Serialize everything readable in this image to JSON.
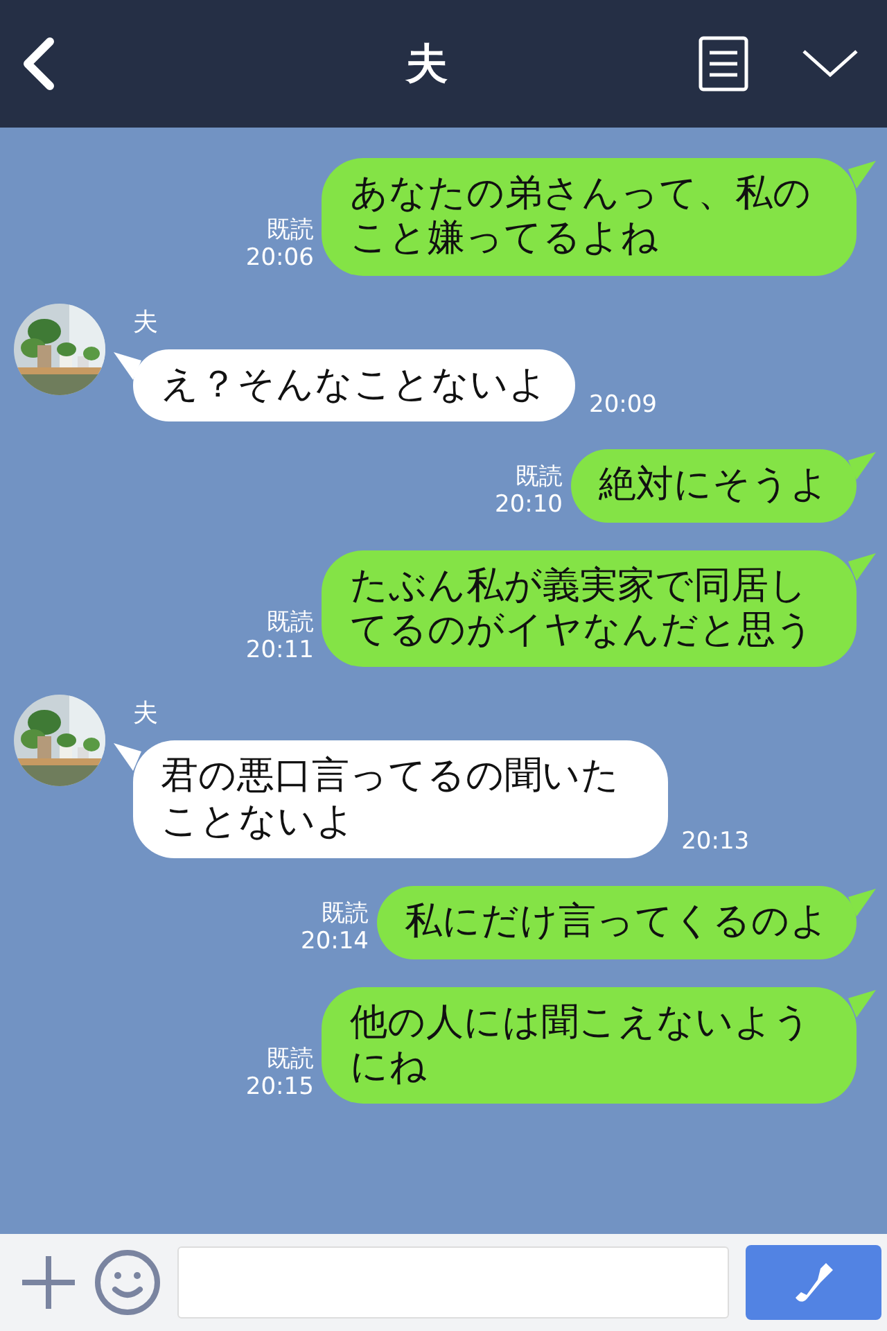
{
  "header": {
    "title": "夫"
  },
  "messages": [
    {
      "kind": "sent",
      "text": "あなたの弟さんって、私のこと嫌ってるよね",
      "read": "既読",
      "time": "20:06"
    },
    {
      "kind": "received",
      "sender": "夫",
      "text": "え？そんなことないよ",
      "time": "20:09"
    },
    {
      "kind": "sent",
      "text": "絶対にそうよ",
      "read": "既読",
      "time": "20:10"
    },
    {
      "kind": "sent",
      "text": "たぶん私が義実家で同居してるのがイヤなんだと思う",
      "read": "既読",
      "time": "20:11"
    },
    {
      "kind": "received",
      "sender": "夫",
      "text": "君の悪口言ってるの聞いたことないよ",
      "time": "20:13"
    },
    {
      "kind": "sent",
      "text": "私にだけ言ってくるのよ",
      "read": "既読",
      "time": "20:14"
    },
    {
      "kind": "sent",
      "text": "他の人には聞こえないようにね",
      "read": "既読",
      "time": "20:15"
    }
  ]
}
